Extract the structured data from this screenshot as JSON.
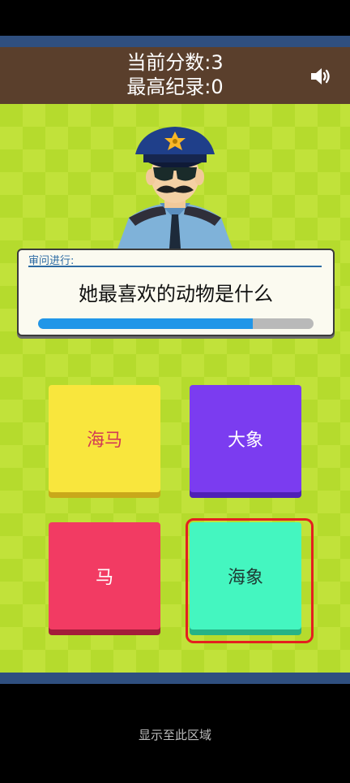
{
  "header": {
    "current_score_label": "当前分数:3",
    "high_score_label": "最高纪录:0"
  },
  "dialog": {
    "label": "审问进行:",
    "question": "她最喜欢的动物是什么",
    "progress_fraction": 0.78
  },
  "answers": [
    {
      "label": "海马"
    },
    {
      "label": "大象"
    },
    {
      "label": "马"
    },
    {
      "label": "海象"
    }
  ],
  "footer": {
    "text": "显示至此区域"
  },
  "icons": {
    "sound": "speaker-icon",
    "character": "police-officer-icon"
  },
  "colors": {
    "header_bg": "#5a3f2c",
    "field_bg": "#b5db2d",
    "progress_fill": "#2196e8",
    "answer_1": "#f9e63d",
    "answer_2": "#7b3cf0",
    "answer_3": "#f23b63",
    "answer_4": "#44f6c0",
    "highlight": "#e41f1f"
  }
}
